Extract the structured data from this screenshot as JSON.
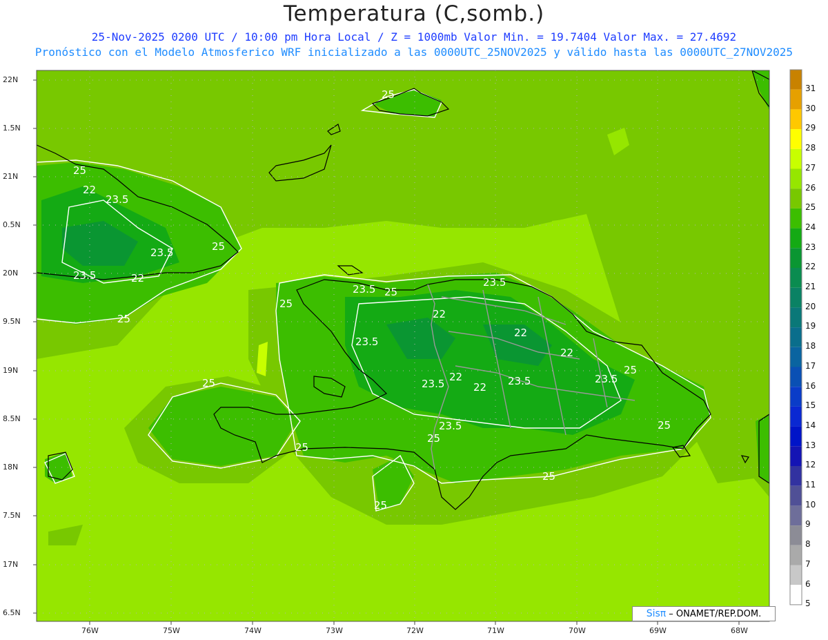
{
  "header": {
    "title": "Temperatura (C,somb.)",
    "line1": "25-Nov-2025 0200 UTC / 10:00 pm Hora Local / Z = 1000mb  Valor Min. = 19.7404  Valor Max. = 27.4692",
    "line2": "Pronóstico con el Modelo Atmosferico WRF inicializado a las 0000UTC_25NOV2025 y válido hasta las  0000UTC_27NOV2025"
  },
  "axes": {
    "lat_labels": [
      "22N",
      "1.5N",
      "21N",
      "0.5N",
      "20N",
      "9.5N",
      "19N",
      "8.5N",
      "18N",
      "7.5N",
      "17N",
      "6.5N"
    ],
    "lon_labels": [
      "76W",
      "75W",
      "74W",
      "73W",
      "72W",
      "71W",
      "70W",
      "69W",
      "68W"
    ]
  },
  "contour_labels": [
    "25",
    "25",
    "22",
    "23.5",
    "23.5",
    "25",
    "23.5",
    "22",
    "25",
    "25",
    "23.5",
    "25",
    "23.5",
    "22",
    "22",
    "23.5",
    "22",
    "22",
    "23.5",
    "22",
    "23.5",
    "23.5",
    "25",
    "23.5",
    "25",
    "25",
    "25",
    "25",
    "25",
    "25"
  ],
  "colorbar": {
    "labels": [
      "31",
      "30",
      "29",
      "28",
      "27",
      "26",
      "25",
      "24",
      "23",
      "22",
      "21",
      "20",
      "19",
      "18",
      "17",
      "16",
      "15",
      "14",
      "13",
      "12",
      "11",
      "10",
      "9",
      "8",
      "7",
      "6",
      "5"
    ],
    "colors": [
      "#c88200",
      "#e6a000",
      "#ffc800",
      "#ffff00",
      "#c8ff00",
      "#96e600",
      "#78c800",
      "#3cbe00",
      "#14aa14",
      "#0a9632",
      "#0a8c50",
      "#0a8264",
      "#0a7878",
      "#0a6e8c",
      "#0a64a0",
      "#0a50b4",
      "#0a3cc8",
      "#0a28d2",
      "#0014c8",
      "#1414b4",
      "#3232a0",
      "#505096",
      "#6e6e9a",
      "#8c8c96",
      "#aaaaaa",
      "#c8c8c8",
      "#ffffff"
    ]
  },
  "credit": {
    "brand": "Sisπ",
    "text": "– ONAMET/REP.DOM."
  }
}
